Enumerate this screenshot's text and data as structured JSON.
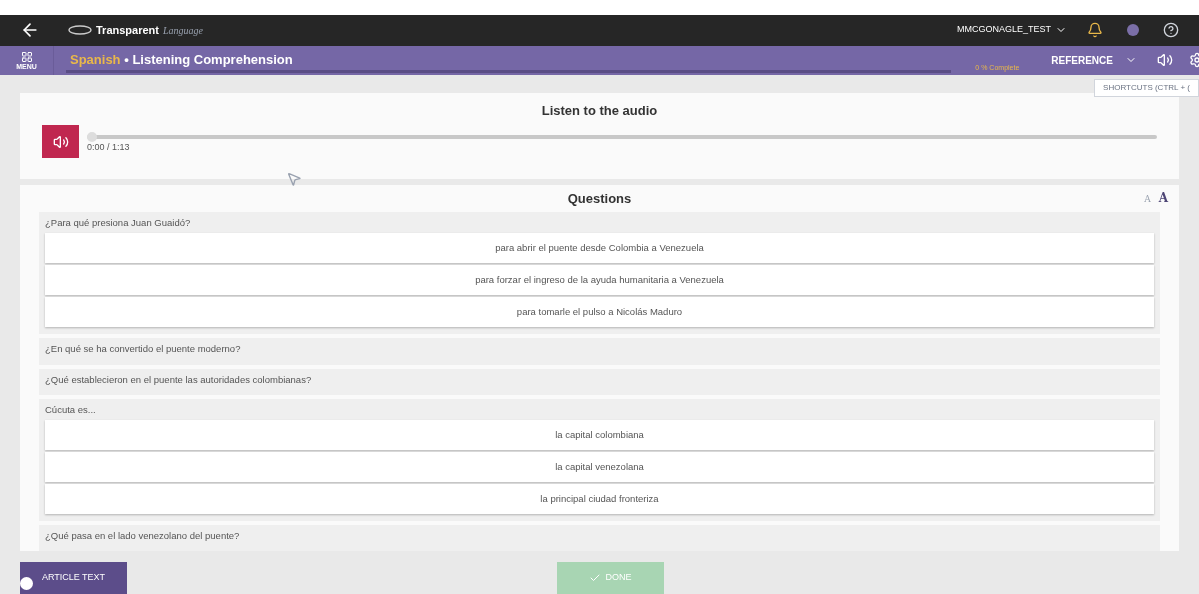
{
  "topbar": {
    "logo_main": "Transparent",
    "logo_sub": "Language",
    "user": "MMCGONAGLE_TEST"
  },
  "header": {
    "menu_label": "MENU",
    "language": "Spanish",
    "separator": "•",
    "title": "Listening Comprehension",
    "progress": {
      "level": 0,
      "label": "0 % Complete"
    },
    "reference": "REFERENCE",
    "tooltip": "SHORTCUTS (CTRL + ("
  },
  "audio": {
    "title": "Listen to the audio",
    "time": "0:00 / 1:13",
    "level": 0
  },
  "questions": {
    "title": "Questions",
    "font_small": "A",
    "font_large": "A",
    "items": [
      {
        "text": "¿Para qué presiona Juan Guaidó?",
        "answers": [
          "para abrir el puente desde Colombia a Venezuela",
          "para forzar el ingreso de la ayuda humanitaria a Venezuela",
          "para tomarle el pulso a Nicolás Maduro"
        ]
      },
      {
        "text": "¿En qué se ha convertido el puente moderno?"
      },
      {
        "text": "¿Qué establecieron en el puente las autoridades colombianas?"
      },
      {
        "text": "Cúcuta es...",
        "answers": [
          "la capital colombiana",
          "la capital venezolana",
          "la principal ciudad fronteriza"
        ]
      },
      {
        "text": "¿Qué pasa en el lado venezolano del puente?"
      }
    ]
  },
  "footer": {
    "article": "ARTICLE TEXT",
    "done": {
      "label": "DONE",
      "disabled": true
    }
  }
}
